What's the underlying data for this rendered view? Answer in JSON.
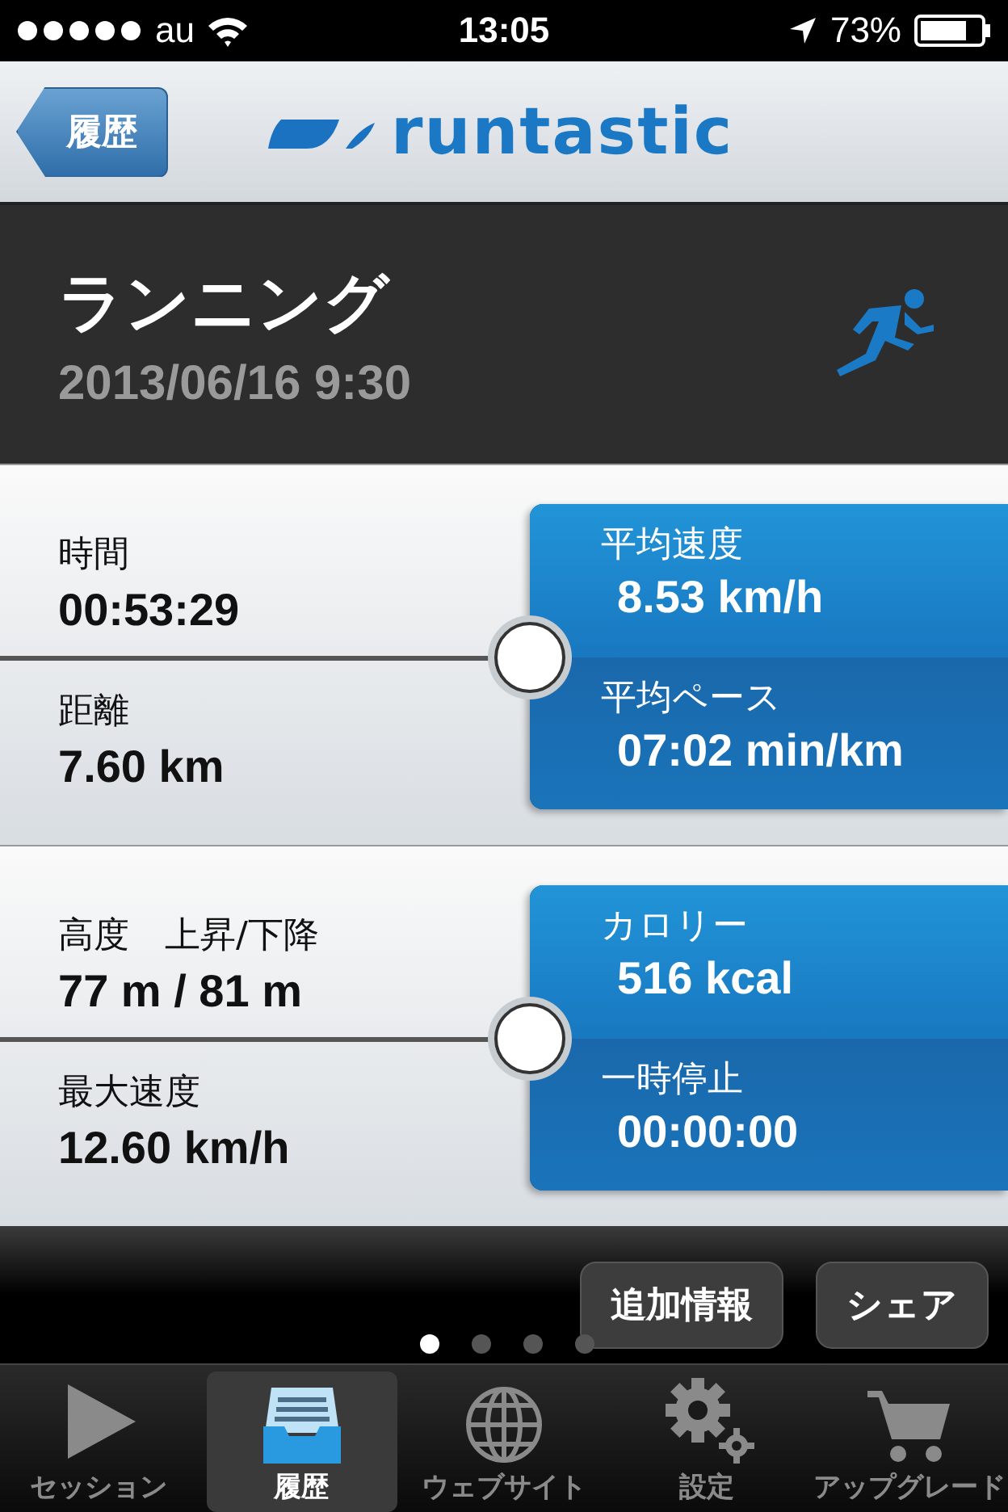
{
  "status_bar": {
    "carrier": "au",
    "time": "13:05",
    "battery": "73%"
  },
  "nav": {
    "back": "履歴",
    "logo": "runtastic"
  },
  "header": {
    "title": "ランニング",
    "datetime": "2013/06/16 9:30"
  },
  "panels": [
    {
      "left": [
        {
          "label": "時間",
          "value": "00:53:29"
        },
        {
          "label": "距離",
          "value": "7.60 km"
        }
      ],
      "right": [
        {
          "label": "平均速度",
          "value": "8.53 km/h"
        },
        {
          "label": "平均ペース",
          "value": "07:02 min/km"
        }
      ]
    },
    {
      "left": [
        {
          "label": "高度　上昇/下降",
          "value": "77 m / 81 m"
        },
        {
          "label": "最大速度",
          "value": "12.60 km/h"
        }
      ],
      "right": [
        {
          "label": "カロリー",
          "value": "516 kcal"
        },
        {
          "label": "一時停止",
          "value": "00:00:00"
        }
      ]
    }
  ],
  "actions": [
    "追加情報",
    "シェア"
  ],
  "pages": [
    {
      "selected": true
    },
    {
      "selected": false
    },
    {
      "selected": false
    },
    {
      "selected": false
    }
  ],
  "tabs": [
    {
      "kind": "play",
      "label": "セッション",
      "selected": false
    },
    {
      "kind": "archive",
      "label": "履歴",
      "selected": true
    },
    {
      "kind": "globe",
      "label": "ウェブサイト",
      "selected": false
    },
    {
      "kind": "gear",
      "label": "設定",
      "selected": false
    },
    {
      "kind": "cart",
      "label": "アップグレード",
      "selected": false
    }
  ]
}
